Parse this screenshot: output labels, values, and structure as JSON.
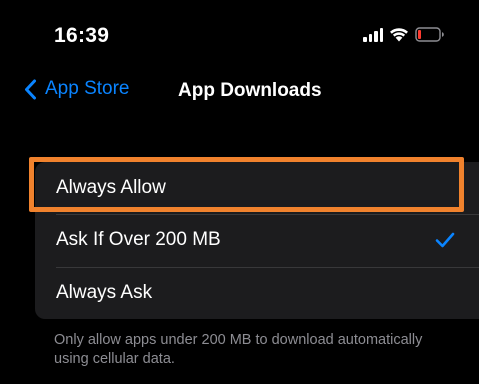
{
  "status_bar": {
    "time": "16:39",
    "icons": [
      "signal-icon",
      "wifi-icon",
      "battery-icon"
    ],
    "battery_color": "#ff3b30"
  },
  "nav": {
    "back_label": "App Store",
    "title": "App Downloads",
    "back_icon": "chevron-left-icon"
  },
  "options": [
    {
      "label": "Always Allow",
      "selected": false,
      "highlighted": true
    },
    {
      "label": "Ask If Over 200 MB",
      "selected": true,
      "highlighted": false
    },
    {
      "label": "Always Ask",
      "selected": false,
      "highlighted": false
    }
  ],
  "footer": "Only allow apps under 200 MB to download automatically using cellular data.",
  "colors": {
    "accent": "#0a84ff",
    "highlight": "#f0822d",
    "background": "#000000",
    "group_background": "#1c1c1e",
    "secondary_text": "#8d8d93"
  }
}
